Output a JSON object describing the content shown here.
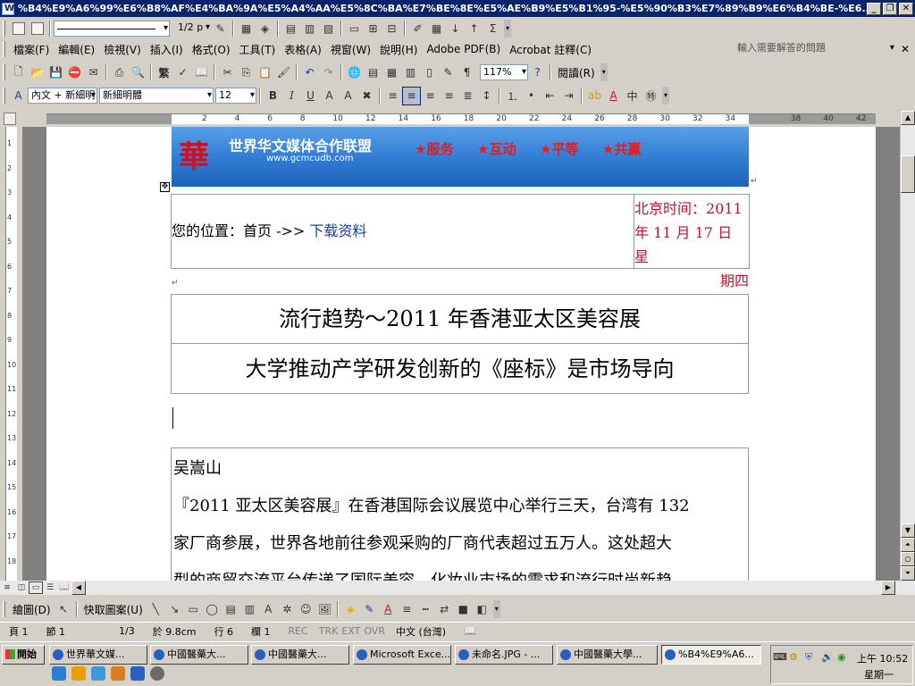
{
  "window": {
    "title": "%B4%E9%A6%99%E6%B8%AF%E4%BA%9A%E5%A4%AA%E5%8C%BA%E7%BE%8E%E5%AE%B9%E5%B1%95-%E5%90%B3%E7%89%B9%E6%B4%BE-%E6..."
  },
  "formatbar_top": {
    "linewidth": "1/2 p"
  },
  "menu": {
    "items": [
      "檔案(F)",
      "編輯(E)",
      "檢視(V)",
      "插入(I)",
      "格式(O)",
      "工具(T)",
      "表格(A)",
      "視窗(W)",
      "說明(H)",
      "Adobe PDF(B)",
      "Acrobat 註釋(C)"
    ],
    "help_placeholder": "輸入需要解答的問題"
  },
  "standard": {
    "zoom": "117%",
    "read_label": "閱讀(R)",
    "trad_label": "繁"
  },
  "formatting": {
    "style": "內文 + 新細明",
    "font": "新細明體",
    "size": "12"
  },
  "ruler": {
    "ticks": [
      "2",
      "4",
      "6",
      "8",
      "10",
      "12",
      "14",
      "16",
      "18",
      "20",
      "22",
      "24",
      "26",
      "28",
      "30",
      "32",
      "34",
      "38",
      "40",
      "42"
    ]
  },
  "vruler": {
    "ticks": [
      "1",
      "2",
      "3",
      "4",
      "5",
      "6",
      "7",
      "8",
      "9",
      "10",
      "11",
      "12",
      "13",
      "14",
      "15",
      "16",
      "17",
      "18"
    ]
  },
  "banner": {
    "logo_char": "華",
    "name": "世界华文媒体合作联盟",
    "url": "www.gcmcudb.com",
    "slogans": [
      "★服务",
      "★互动",
      "★平等",
      "★共赢"
    ]
  },
  "location": {
    "prefix": "您的位置：首页 ->> ",
    "link": "下载资料"
  },
  "datetime": {
    "line1": "北京时间：2011",
    "line2": "年 11 月 17 日 星",
    "line3": "期四"
  },
  "headline1": "流行趋势～2011 年香港亚太区美容展",
  "headline2": "大学推动产学研发创新的《座标》是市场导向",
  "author": "吴嵩山",
  "body": [
    "『2011 亚太区美容展』在香港国际会议展览中心举行三天，台湾有 132",
    "家厂商参展，世界各地前往参观采购的厂商代表超过五万人。这处超大",
    "型的商贸交流平台传递了国际美容、化妆业市场的需求和流行时尚新趋"
  ],
  "drawing": {
    "draw_label": "繪圖(D)",
    "autoshape_label": "快取圖案(U)"
  },
  "status": {
    "page": "頁 1",
    "section": "節 1",
    "pages": "1/3",
    "at": "於 9.8cm",
    "line": "行 6",
    "col": "欄 1",
    "rec": "REC",
    "trk": "TRK",
    "ext": "EXT",
    "ovr": "OVR",
    "lang": "中文 (台灣)"
  },
  "taskbar": {
    "start": "開始",
    "tasks": [
      "世界華文媒...",
      "中國醫藥大...",
      "中國醫藥大...",
      "Microsoft Exce...",
      "未命名.JPG - ...",
      "中國醫藥大學...",
      "%B4%E9%A6..."
    ],
    "time": "上午 10:52",
    "day": "星期一"
  },
  "colors": {
    "title_bg": "#0a246a",
    "banner_blue": "#2f7bd4",
    "red_text": "#c8102e",
    "link_blue": "#1a3c9e"
  }
}
